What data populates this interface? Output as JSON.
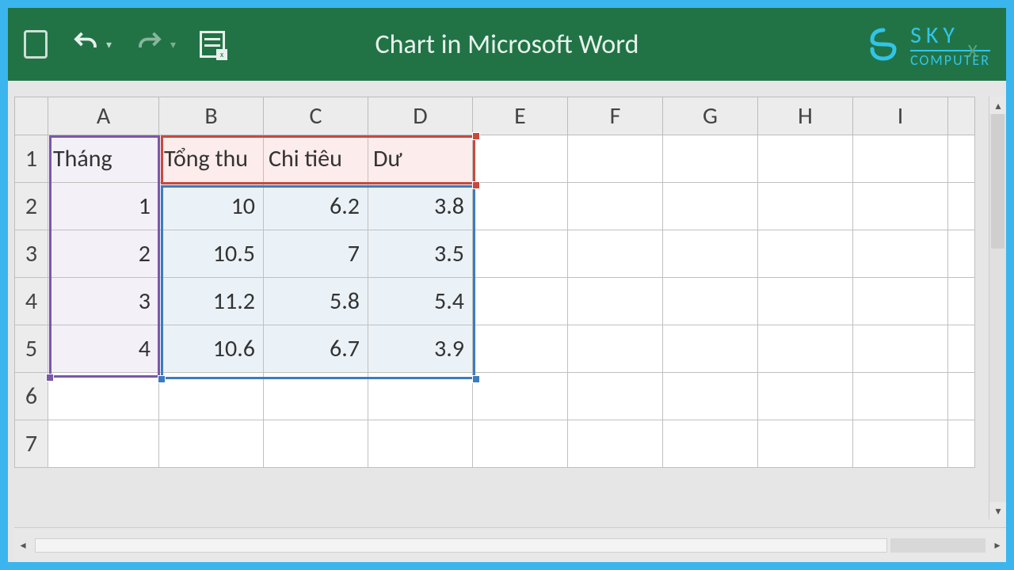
{
  "window": {
    "title": "Chart in Microsoft Word",
    "close_label": "X"
  },
  "brand": {
    "line1": "SKY",
    "line2": "COMPUTER"
  },
  "columns": [
    "A",
    "B",
    "C",
    "D",
    "E",
    "F",
    "G",
    "H",
    "I"
  ],
  "rows": [
    "1",
    "2",
    "3",
    "4",
    "5",
    "6",
    "7"
  ],
  "grid": {
    "r1": {
      "A": "Tháng",
      "B": "Tổng thu",
      "C": "Chi tiêu",
      "D": "Dư"
    },
    "r2": {
      "A": "1",
      "B": "10",
      "C": "6.2",
      "D": "3.8"
    },
    "r3": {
      "A": "2",
      "B": "10.5",
      "C": "7",
      "D": "3.5"
    },
    "r4": {
      "A": "3",
      "B": "11.2",
      "C": "5.8",
      "D": "5.4"
    },
    "r5": {
      "A": "4",
      "B": "10.6",
      "C": "6.7",
      "D": "3.9"
    }
  },
  "chart_data": {
    "type": "bar",
    "title": "Chart in Microsoft Word",
    "xlabel": "Tháng",
    "categories": [
      "1",
      "2",
      "3",
      "4"
    ],
    "series": [
      {
        "name": "Tổng thu",
        "values": [
          10,
          10.5,
          11.2,
          10.6
        ]
      },
      {
        "name": "Chi tiêu",
        "values": [
          6.2,
          7,
          5.8,
          6.7
        ]
      },
      {
        "name": "Dư",
        "values": [
          3.8,
          3.5,
          5.4,
          3.9
        ]
      }
    ]
  }
}
